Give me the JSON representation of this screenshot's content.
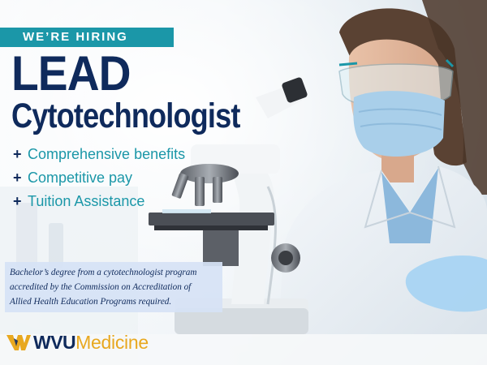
{
  "banner": {
    "label": "WE’RE HIRING"
  },
  "title": {
    "line1": "LEAD",
    "line2": "Cytotechnologist"
  },
  "benefits": [
    {
      "symbol": "+",
      "text": "Comprehensive benefits"
    },
    {
      "symbol": "+",
      "text": "Competitive pay"
    },
    {
      "symbol": "+",
      "text": "Tuition Assistance"
    }
  ],
  "requirement": {
    "line1": "Bachelor’s degree from a cytotechnologist program",
    "line2": "accredited by the Commission on Accreditation of",
    "line3": "Allied Health Education Programs required."
  },
  "brand": {
    "wvu": "WVU",
    "medicine": "Medicine",
    "logo_icon": "flying-wv-icon"
  },
  "colors": {
    "navy": "#0f2a5c",
    "teal": "#1b97a8",
    "gold": "#e8a81f",
    "requirement_bg": "#d6e2f5"
  }
}
